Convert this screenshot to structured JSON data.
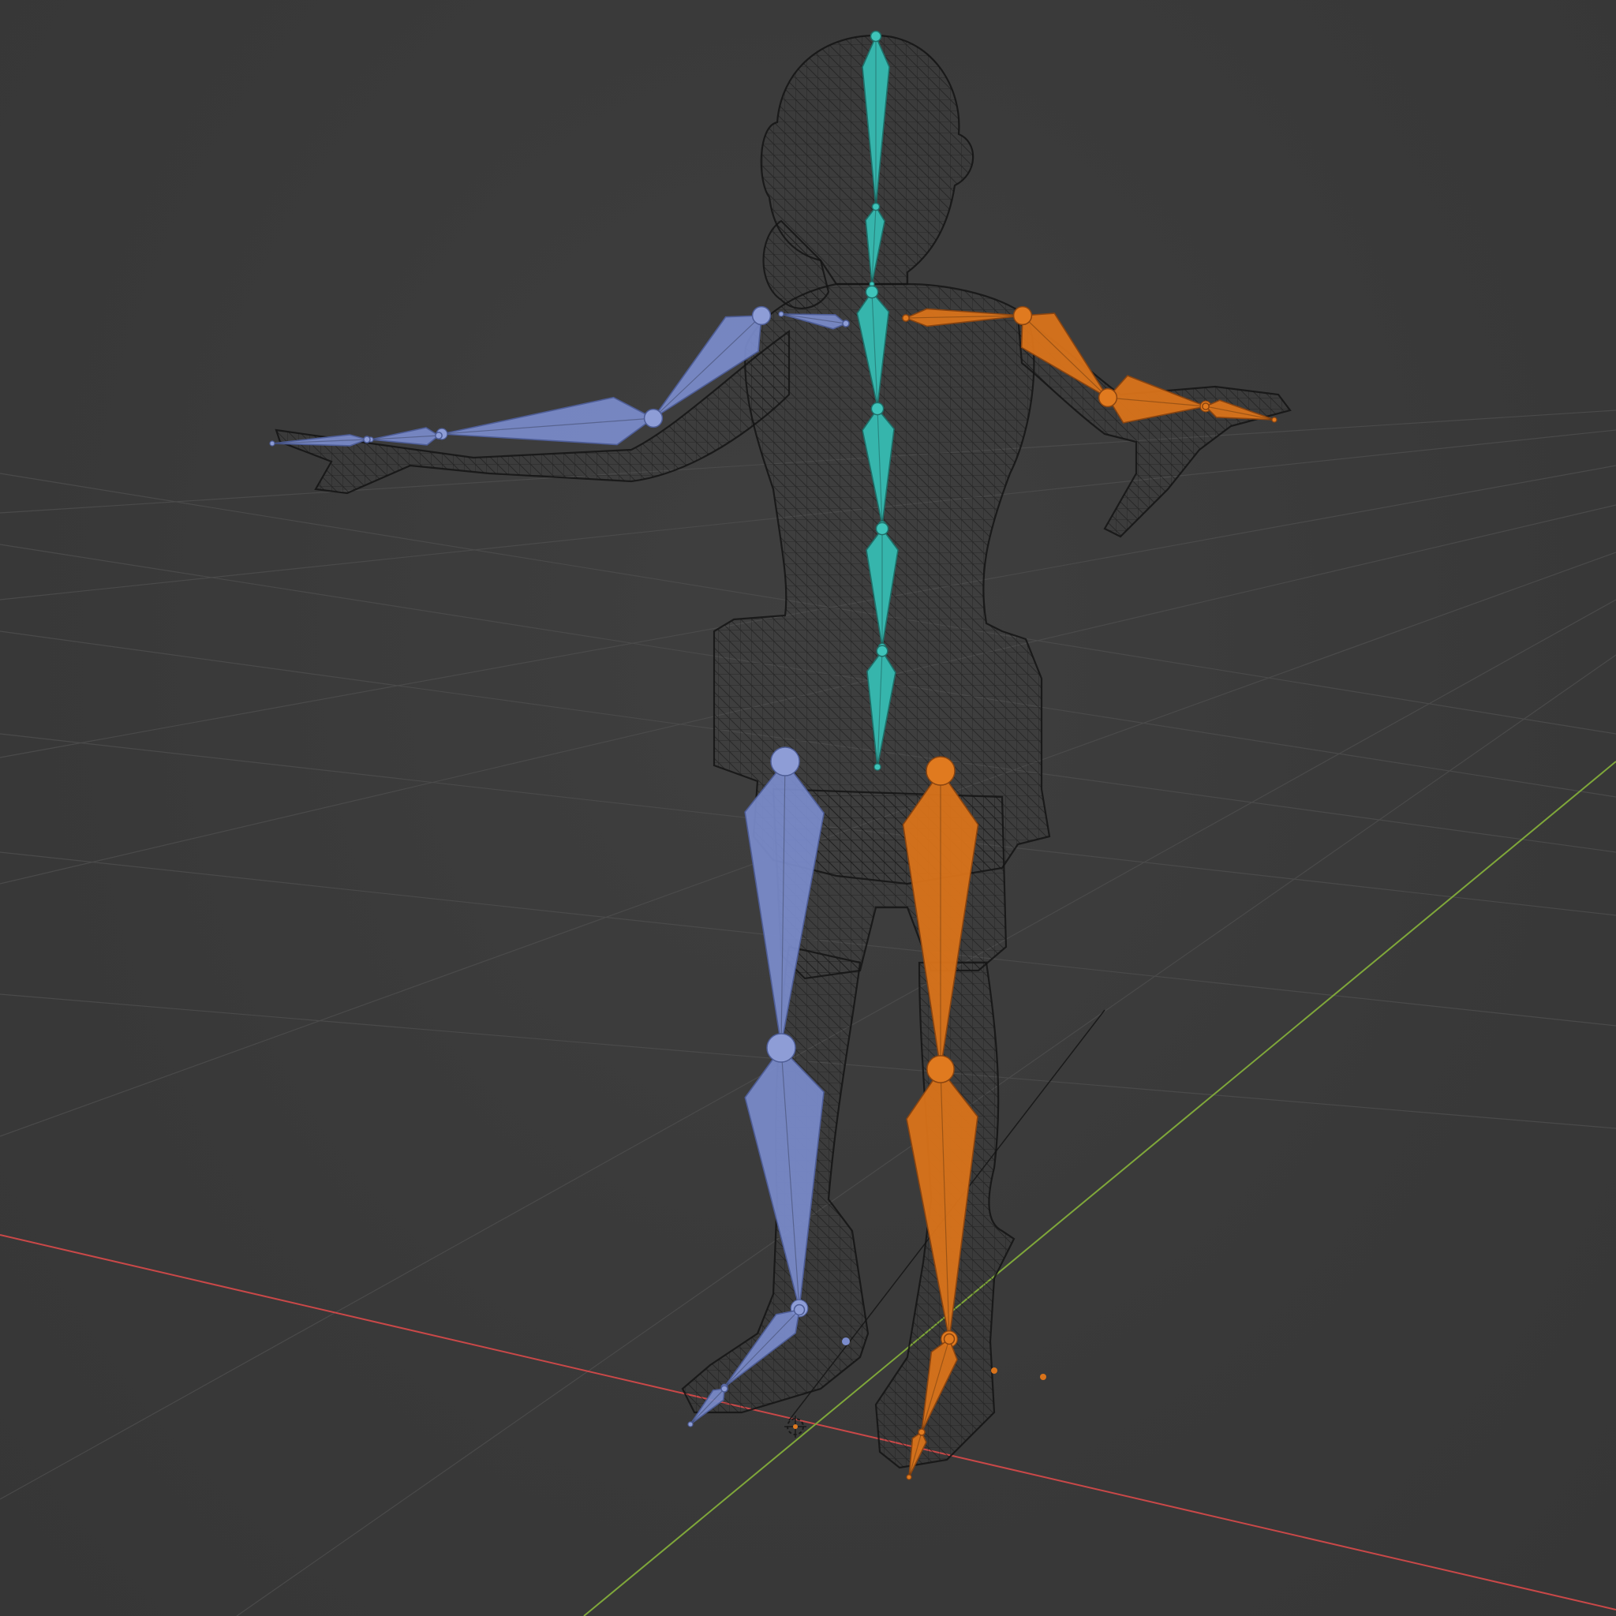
{
  "viewport": {
    "background_color": "#3a3a3a",
    "grid_line_color": "#4a4a4a",
    "axis_x_color": "#c94848",
    "axis_y_color": "#7fa73a"
  },
  "armature": {
    "spine_color": "#36b5ac",
    "left_side_color": "#7b8ccc",
    "right_side_color": "#d9731a",
    "display": "octahedral"
  },
  "mesh": {
    "display": "wireframe",
    "wire_color": "#141414"
  },
  "icons": {
    "origin": "3d-cursor-icon"
  }
}
